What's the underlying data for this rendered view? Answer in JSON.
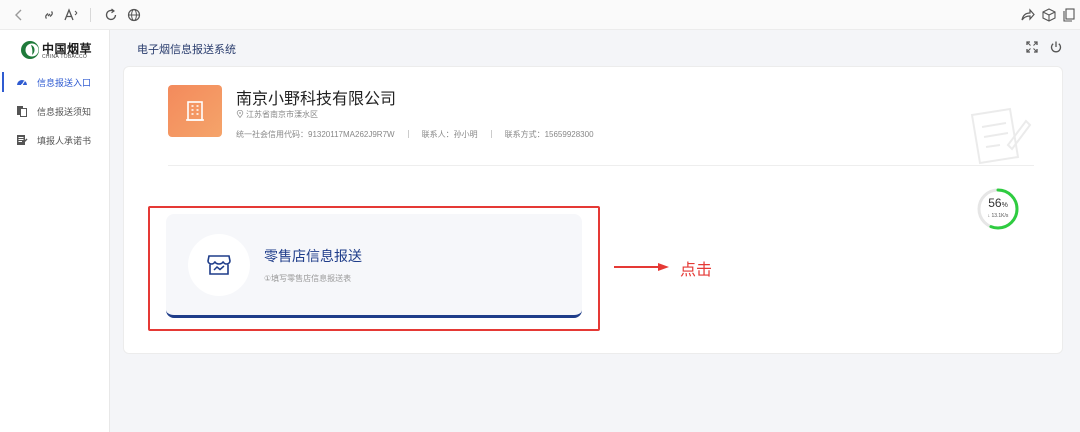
{
  "browser": {
    "icons": [
      "back-icon",
      "link-icon",
      "read-aloud-icon",
      "refresh-icon",
      "globe-icon",
      "share-icon",
      "extension-icon",
      "collections-icon"
    ]
  },
  "sidebar": {
    "logo_text": "中国烟草",
    "logo_sub": "CHINA TOBACCO",
    "items": [
      {
        "label": "信息报送入口",
        "icon": "dashboard-icon",
        "active": true
      },
      {
        "label": "信息报送须知",
        "icon": "documents-icon",
        "active": false
      },
      {
        "label": "填报人承诺书",
        "icon": "pledge-icon",
        "active": false
      }
    ]
  },
  "header": {
    "title": "电子烟信息报送系统",
    "icons": [
      "fullscreen-icon",
      "power-icon"
    ]
  },
  "company": {
    "name": "南京小野科技有限公司",
    "address": "江苏省南京市溧水区",
    "credit_code": "统一社会信用代码：91320117MA262J9R7W",
    "contact": "联系人：孙小明",
    "phone": "联系方式：15659928300"
  },
  "speed": {
    "percent": "56",
    "percent_unit": "%",
    "rate": "↓ 13.1K/s",
    "progress": 0.56
  },
  "report": {
    "title": "零售店信息报送",
    "subtitle": "①填写零售店信息报送表"
  },
  "annotation": {
    "text": "点击"
  },
  "colors": {
    "accent": "#2f5bd1",
    "navy": "#1f3d8a",
    "orange": "#f38a5c",
    "annotation_red": "#e53935",
    "progress_green": "#2ecc40"
  }
}
